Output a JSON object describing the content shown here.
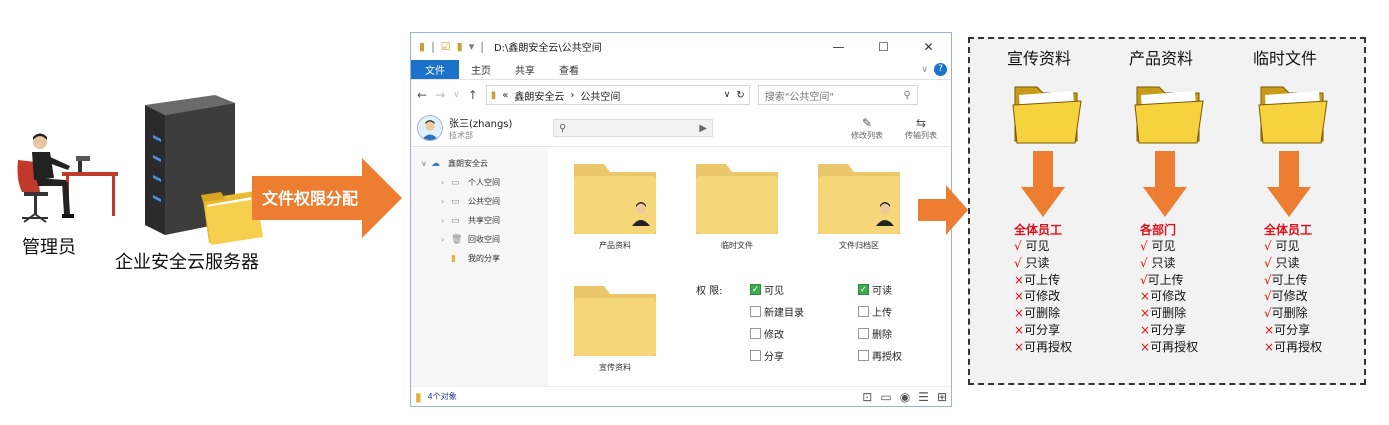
{
  "colors": {
    "arrow": "#ed7d31",
    "ribbon": "#1a73c8",
    "folder": "#f5d77a",
    "mark": "#e0101a"
  },
  "left": {
    "admin_label": "管理员",
    "server_label": "企业安全云服务器",
    "arrow_label": "文件权限分配"
  },
  "explorer": {
    "path_title": "D:\\鑫朗安全云\\公共空间",
    "window_controls": [
      "—",
      "☐",
      "✕"
    ],
    "ribbon_tabs": [
      "文件",
      "主页",
      "共享",
      "查看"
    ],
    "address_parts": [
      "«",
      "鑫朗安全云",
      "›",
      "公共空间"
    ],
    "search_placeholder": "搜索\"公共空间\"",
    "user_name": "张三(zhangs)",
    "user_role": "技术部",
    "tools": [
      "修改列表",
      "传输列表"
    ],
    "tree": [
      {
        "label": "鑫朗安全云",
        "expanded": true,
        "level": 0
      },
      {
        "label": "个人空间",
        "level": 1
      },
      {
        "label": "公共空间",
        "level": 1
      },
      {
        "label": "共享空间",
        "level": 1
      },
      {
        "label": "回收空间",
        "level": 1
      },
      {
        "label": "我的分享",
        "level": 1
      }
    ],
    "folders": [
      "产品资料",
      "临时文件",
      "文件归档区",
      "宣传资料"
    ],
    "permission_title": "权    限:",
    "permissions": [
      {
        "label": "可见",
        "checked": true
      },
      {
        "label": "可读",
        "checked": true
      },
      {
        "label": "新建目录",
        "checked": false
      },
      {
        "label": "上传",
        "checked": false
      },
      {
        "label": "修改",
        "checked": false
      },
      {
        "label": "删除",
        "checked": false
      },
      {
        "label": "分享",
        "checked": false
      },
      {
        "label": "再授权",
        "checked": false
      }
    ],
    "status_text": "4个对象"
  },
  "panel": {
    "columns": [
      {
        "title": "宣传资料",
        "audience": "全体员工",
        "items": [
          {
            "mark": "√",
            "text": " 可见"
          },
          {
            "mark": "√",
            "text": " 只读"
          },
          {
            "mark": "×",
            "text": "可上传"
          },
          {
            "mark": "×",
            "text": "可修改"
          },
          {
            "mark": "×",
            "text": "可删除"
          },
          {
            "mark": "×",
            "text": "可分享"
          },
          {
            "mark": "×",
            "text": "可再授权"
          }
        ]
      },
      {
        "title": "产品资料",
        "audience": "各部门",
        "items": [
          {
            "mark": "√",
            "text": " 可见"
          },
          {
            "mark": "√",
            "text": " 只读"
          },
          {
            "mark": "√",
            "text": "可上传"
          },
          {
            "mark": "×",
            "text": "可修改"
          },
          {
            "mark": "×",
            "text": "可删除"
          },
          {
            "mark": "×",
            "text": "可分享"
          },
          {
            "mark": "×",
            "text": "可再授权"
          }
        ]
      },
      {
        "title": "临时文件",
        "audience": "全体员工",
        "items": [
          {
            "mark": "√",
            "text": " 可见"
          },
          {
            "mark": "√",
            "text": " 只读"
          },
          {
            "mark": "√",
            "text": "可上传"
          },
          {
            "mark": "√",
            "text": "可修改"
          },
          {
            "mark": "√",
            "text": "可删除"
          },
          {
            "mark": "×",
            "text": "可分享"
          },
          {
            "mark": "×",
            "text": "可再授权"
          }
        ]
      }
    ]
  }
}
